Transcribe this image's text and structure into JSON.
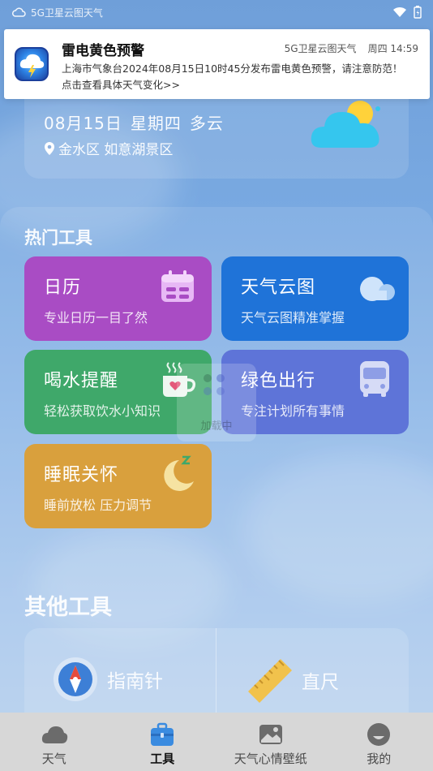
{
  "status_bar": {
    "app_label": "5G卫星云图天气"
  },
  "notification": {
    "title": "雷电黄色预警",
    "app_name": "5G卫星云图天气",
    "day": "周四",
    "time": "14:59",
    "line1": "上海市气象台2024年08月15日10时45分发布雷电黄色预警，请注意防范！",
    "line2": "点击查看具体天气变化>>"
  },
  "weather": {
    "date": "08月15日",
    "weekday": "星期四",
    "condition": "多云",
    "location": "金水区 如意湖景区"
  },
  "hot_tools": {
    "title": "热门工具",
    "items": [
      {
        "name": "日历",
        "desc": "专业日历一目了然",
        "icon": "calendar-icon"
      },
      {
        "name": "天气云图",
        "desc": "天气云图精准掌握",
        "icon": "cloud-icon"
      },
      {
        "name": "喝水提醒",
        "desc": "轻松获取饮水小知识",
        "icon": "cup-icon"
      },
      {
        "name": "绿色出行",
        "desc": "专注计划所有事情",
        "icon": "bus-icon"
      },
      {
        "name": "睡眠关怀",
        "desc": "睡前放松 压力调节",
        "icon": "moon-icon"
      }
    ]
  },
  "loading_text": "加载中",
  "other_tools": {
    "title": "其他工具",
    "items": [
      {
        "name": "指南针",
        "icon": "compass-icon"
      },
      {
        "name": "直尺",
        "icon": "ruler-icon"
      }
    ]
  },
  "bottom_nav": {
    "active_index": 1,
    "items": [
      {
        "label": "天气",
        "icon": "weather-icon"
      },
      {
        "label": "工具",
        "icon": "toolbox-icon"
      },
      {
        "label": "天气心情壁纸",
        "icon": "wallpaper-icon"
      },
      {
        "label": "我的",
        "icon": "profile-icon"
      }
    ]
  },
  "colors": {
    "calendar": "#a94cc4",
    "cloud": "#1f73d8",
    "water": "#3fa86a",
    "bus": "#5e74d8",
    "sleep": "#d9a03d"
  }
}
